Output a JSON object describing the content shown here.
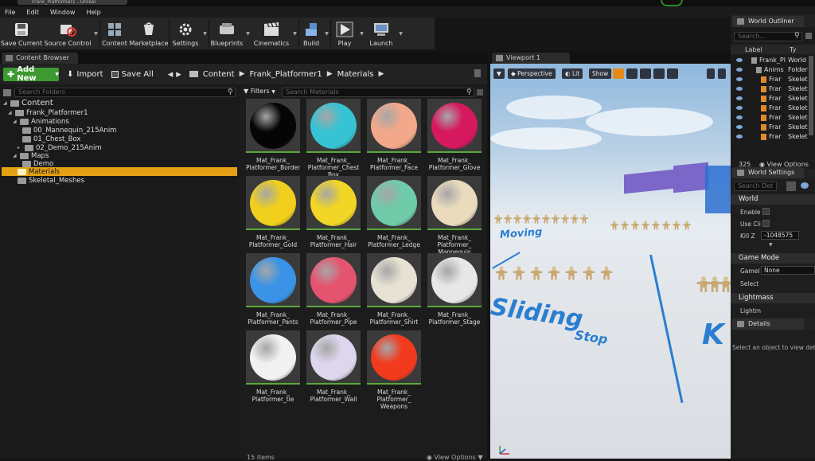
{
  "window": {
    "title": "Frank_Platformer1 - Unreal"
  },
  "menu": [
    "File",
    "Edit",
    "Window",
    "Help"
  ],
  "toolbar": [
    {
      "label": "Save Current",
      "icon": "save-icon"
    },
    {
      "label": "Source Control",
      "icon": "source-control-icon"
    },
    {
      "label": "Content",
      "icon": "content-icon"
    },
    {
      "label": "Marketplace",
      "icon": "marketplace-icon"
    },
    {
      "label": "Settings",
      "icon": "settings-icon"
    },
    {
      "label": "Blueprints",
      "icon": "blueprints-icon"
    },
    {
      "label": "Cinematics",
      "icon": "cinematics-icon"
    },
    {
      "label": "Build",
      "icon": "build-icon"
    },
    {
      "label": "Play",
      "icon": "play-icon"
    },
    {
      "label": "Launch",
      "icon": "launch-icon"
    }
  ],
  "content_browser": {
    "tab_title": "Content Browser",
    "add_new": "Add New",
    "import": "Import",
    "save_all": "Save All",
    "breadcrumb": [
      "Content",
      "Frank_Platformer1",
      "Materials"
    ],
    "search_folders_placeholder": "Search Folders",
    "filters_label": "Filters",
    "search_materials_placeholder": "Search Materials",
    "tree": [
      {
        "label": "Content",
        "level": 0
      },
      {
        "label": "Frank_Platformer1",
        "level": 1
      },
      {
        "label": "Animations",
        "level": 2
      },
      {
        "label": "00_Mannequin_215Anim",
        "level": 3
      },
      {
        "label": "01_Chest_Box",
        "level": 3
      },
      {
        "label": "02_Demo_215Anim",
        "level": 3
      },
      {
        "label": "Maps",
        "level": 2
      },
      {
        "label": "Demo",
        "level": 3
      },
      {
        "label": "Materials",
        "level": 2,
        "selected": true
      },
      {
        "label": "Skeletal_Meshes",
        "level": 2
      }
    ],
    "materials": [
      {
        "name": "Mat_Frank_\nPlatformer_Border",
        "color": "#050505"
      },
      {
        "name": "Mat_Frank_\nPlatformer_Chest\nBox",
        "color": "#36c3d4"
      },
      {
        "name": "Mat_Frank_\nPlatformer_Face",
        "color": "#f2a88a"
      },
      {
        "name": "Mat_Frank_\nPlatformer_Glove",
        "color": "#d6185f"
      },
      {
        "name": "Mat_Frank_\nPlatformer_Gold",
        "color": "#f0cf1d"
      },
      {
        "name": "Mat_Frank_\nPlatformer_Hair",
        "color": "#f2d625"
      },
      {
        "name": "Mat_Frank_\nPlatformer_Ledge",
        "color": "#6fcba9"
      },
      {
        "name": "Mat_Frank_\nPlatformer_\nMannequin",
        "color": "#eadbbd"
      },
      {
        "name": "Mat_Frank_\nPlatformer_Pants",
        "color": "#3a93e6"
      },
      {
        "name": "Mat_Frank_\nPlatformer_Pipe",
        "color": "#e5546f"
      },
      {
        "name": "Mat_Frank_\nPlatformer_Shirt",
        "color": "#e6e1d2"
      },
      {
        "name": "Mat_Frank_\nPlatformer_Stage",
        "color": "#e7e7e7"
      },
      {
        "name": "Mat_Frank_\nPlatformer_tie",
        "color": "#f1f1f1"
      },
      {
        "name": "Mat_Frank_\nPlatformer_Wall",
        "color": "#ddd6ec"
      },
      {
        "name": "Mat_Frank_\nPlatformer_\nWeapons",
        "color": "#f23a1e"
      }
    ],
    "item_count": "15 items",
    "view_options": "View Options"
  },
  "viewport": {
    "tab_title": "Viewport 1",
    "perspective": "Perspective",
    "lit": "Lit",
    "show": "Show",
    "scene_labels": [
      "Moving",
      "Sliding",
      "Stop",
      "K"
    ]
  },
  "world_outliner": {
    "tab_title": "World Outliner",
    "search_placeholder": "Search...",
    "col_label": "Label",
    "col_type": "Ty",
    "rows": [
      {
        "label": "Frank_Pl",
        "type": "World"
      },
      {
        "label": "Anims",
        "type": "Folder"
      },
      {
        "label": "Frar",
        "type": "Skelet"
      },
      {
        "label": "Frar",
        "type": "Skelet"
      },
      {
        "label": "Frar",
        "type": "Skelet"
      },
      {
        "label": "Frar",
        "type": "Skelet"
      },
      {
        "label": "Frar",
        "type": "Skelet"
      },
      {
        "label": "Frar",
        "type": "Skelet"
      },
      {
        "label": "Frar",
        "type": "Skelet"
      }
    ],
    "count": "325",
    "view_options": "View Options"
  },
  "world_settings": {
    "tab_title": "World Settings",
    "search_placeholder": "Search Det",
    "world_section": "World",
    "enable_label": "Enable",
    "use_cl_label": "Use Cli",
    "kill_z_label": "Kill Z",
    "kill_z_value": "-1048575",
    "game_mode_section": "Game Mode",
    "game_label": "GameI",
    "game_value": "None",
    "select_label": "Select",
    "lightmass_section": "Lightmass",
    "lightmass_label": "Lightm"
  },
  "details": {
    "tab_title": "Details",
    "hint": "Select an object to view deta"
  }
}
